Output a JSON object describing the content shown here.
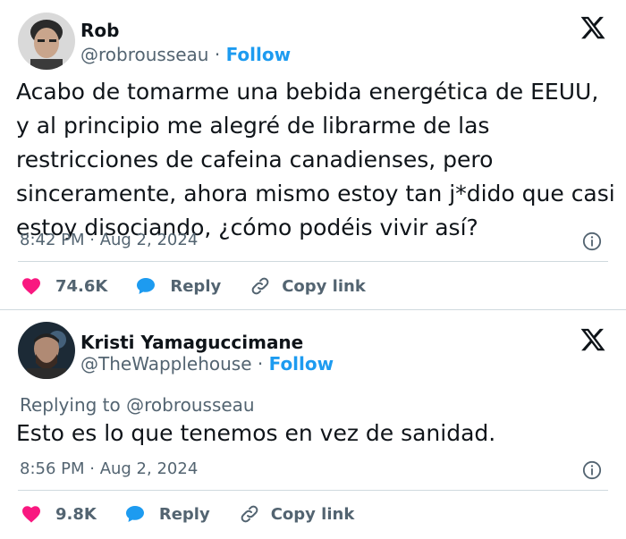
{
  "tweets": [
    {
      "author_name": "Rob",
      "handle": "@robrousseau",
      "separator": "·",
      "follow_label": "Follow",
      "text": "Acabo de tomarme una bebida energética de EEUU, y al principio me alegré de librarme de las restricciones de cafeina canadienses, pero sinceramente, ahora mismo estoy tan j*dido que casi estoy disociando, ¿cómo podéis vivir así?",
      "timestamp": "8:42 PM · Aug 2, 2024",
      "likes": "74.6K",
      "reply_label": "Reply",
      "copy_link_label": "Copy link"
    },
    {
      "author_name": "Kristi Yamaguccimane",
      "handle": "@TheWapplehouse",
      "separator": "·",
      "follow_label": "Follow",
      "replying_to": "Replying to @robrousseau",
      "text": "Esto es lo que tenemos en vez de sanidad.",
      "timestamp": "8:56 PM · Aug 2, 2024",
      "likes": "9.8K",
      "reply_label": "Reply",
      "copy_link_label": "Copy link"
    }
  ],
  "colors": {
    "text": "#0f1419",
    "muted": "#536471",
    "accent": "#1d9bf0",
    "like": "#f91880",
    "border": "#cfd9de"
  },
  "icons": [
    "x-logo-icon",
    "info-icon",
    "heart-icon",
    "reply-bubble-icon",
    "link-icon"
  ]
}
